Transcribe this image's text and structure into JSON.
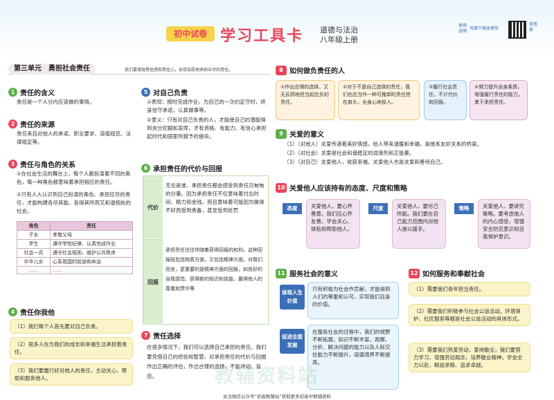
{
  "header": {
    "badge": "初中试卷",
    "title": "学习工具卡",
    "subject": "道德与法治",
    "grade": "八年级上册",
    "use_note_a": "使用",
    "use_note_b": "说明",
    "portable": "可撕下随身携带",
    "qr_note": "查答案"
  },
  "unit": {
    "title": "第三单元　勇担社会责任",
    "subtitle": "我们要增强责任感和责任心，自觉自愿地承担应尽的责任。"
  },
  "s1": {
    "num": "1",
    "title": "责任的含义",
    "text": "责任是一个人分内应该做的事情。"
  },
  "s2": {
    "num": "2",
    "title": "责任的来源",
    "text": "责任来自对他人的承诺、职业要求、道德规范、法律规定等。"
  },
  "s3": {
    "num": "3",
    "title": "责任与角色的关系",
    "p1": "①在社会生活的舞台上，每个人都扮演着不同的角色，每一种角色都意味着承担相应的责任。",
    "p2": "②只有人人认识到自己扮演的角色、承担应尽的责任，才能构建各尽其能、各得其所而又和谐相处的社会。",
    "head": [
      "角色",
      "责任"
    ],
    "rows": [
      [
        "子女",
        "孝敬父母"
      ],
      [
        "学生",
        "遵守学校纪律、认真完成作业"
      ],
      [
        "社会一员",
        "遵守社会规则、维护公共秩序"
      ],
      [
        "中华儿女",
        "心系祖国的前途和命运"
      ],
      [
        "……",
        "……"
      ]
    ]
  },
  "s4": {
    "num": "4",
    "title": "责任你我他",
    "items": [
      "（1）我们每个人首先要对自己负责。",
      "（2）很多人在为我们的成长和幸福生活承担着责任。",
      "（3）我们要履行好对他人的责任，主动关心、帮助和服务他人。"
    ]
  },
  "s5": {
    "num": "5",
    "title": "对自己负责",
    "p1": "①表现：按时完成作业，为自己的一次约定守时，终身信守承诺，认真做事等。",
    "p2": "②意义：只有对自己负责的人，才能使自己的潜能得到充分挖掘和发挥，才有资格、有能力、有信心承担起时代和国家所赋予的使命。"
  },
  "s6": {
    "num": "6",
    "title": "承担责任的代价与回报",
    "rows": [
      {
        "label": "代价",
        "text": "无论是谁，承担责任都会感受到责任沉甸甸的分量。因为承担责任不仅意味着付出时间、精力和金钱，而且意味着可能因为做得不好而受到责备，甚至受到处罚"
      },
      {
        "label": "回报",
        "text": "承担责任往往伴随着获得回报的权利。这种回报既包括物质方面，又包括精神方面。对我们而言，更重要的是精神方面的回报，如良好的自我感觉、获得新的知识和技能、赢得他人的尊重和赞许等"
      }
    ]
  },
  "s7": {
    "num": "7",
    "title": "责任选择",
    "text": "在很多情况下，我们可以选择自己承担的责任。我们要凭借自己的经验和智慧，对承担责任的代价与回报作出正确的评估，作出合理的选择，不能冲动、盲目。"
  },
  "s8": {
    "num": "8",
    "title": "如何做负责任的人",
    "steps": [
      "①作出合理的选择，又无反顾地担当起应负的责任。",
      "②对于不是自己选择的责任，我们也应当作一种可推卸的责任担在肩头，全身心地投入。",
      "③履行社会责任，不计代价和回报。",
      "④努力提升自身素质，增强履行责任的能力，勇于承担责任。"
    ]
  },
  "s9": {
    "num": "9",
    "title": "关爱的意义",
    "items": [
      "（1）（对他人）关爱传递着美好情感，给人带来温暖和幸福，是维系友好关系的桥梁。",
      "（2）（对社会）关爱是社会和谐稳定的润滑剂和正能量。",
      "（3）（对自己）关爱他人，收获幸福。关爱他人也是关爱和善待自己。"
    ]
  },
  "s10": {
    "num": "10",
    "title": "关爱他人应该持有的态度、尺度和策略",
    "cards": [
      {
        "label": "态度",
        "text": "关爱他人，要心怀善意。我们应心怀友善，学会关心、体贴和帮助他人。"
      },
      {
        "label": "尺度",
        "text": "关爱他人，要尽己所能。我们要在自己能力范围内对他人施以援手。"
      },
      {
        "label": "策略",
        "text": "关爱他人，要讲究策略。要考虑他人的内心感受，增强安全防范意识和自我保护意识。"
      }
    ]
  },
  "s11": {
    "num": "11",
    "title": "服务社会的意义",
    "cards": [
      {
        "label": "体现人生价值",
        "text": "只有积极为社会作贡献，才能得到人们的尊重和认可，实现我们自身的价值。"
      },
      {
        "label": "促进全面发展",
        "text": "在服务社会的过程中，我们的视野不断拓展，知识不断丰富，观察、分析、解决问题的能力以及人际交往能力不断提升，道德境界不断提高。"
      }
    ]
  },
  "s12": {
    "num": "12",
    "title": "如何服务和奉献社会",
    "items": [
      "（1）需要我们青年担当责任。",
      "（2）需要我们积极参与社会公益活动。环境保护、社区服务等都是社会公益活动的具体形式。",
      "（3）需要我们热爱劳动，爱岗敬业，我们要努力学习，增强劳动观念，培养敬业精神，学会全力以赴、精益求精、追求卓越。"
    ]
  },
  "footer": "关注微信公众号“初高数辅站”获取更多初高中数辅资料",
  "watermark": "教辅资料站"
}
